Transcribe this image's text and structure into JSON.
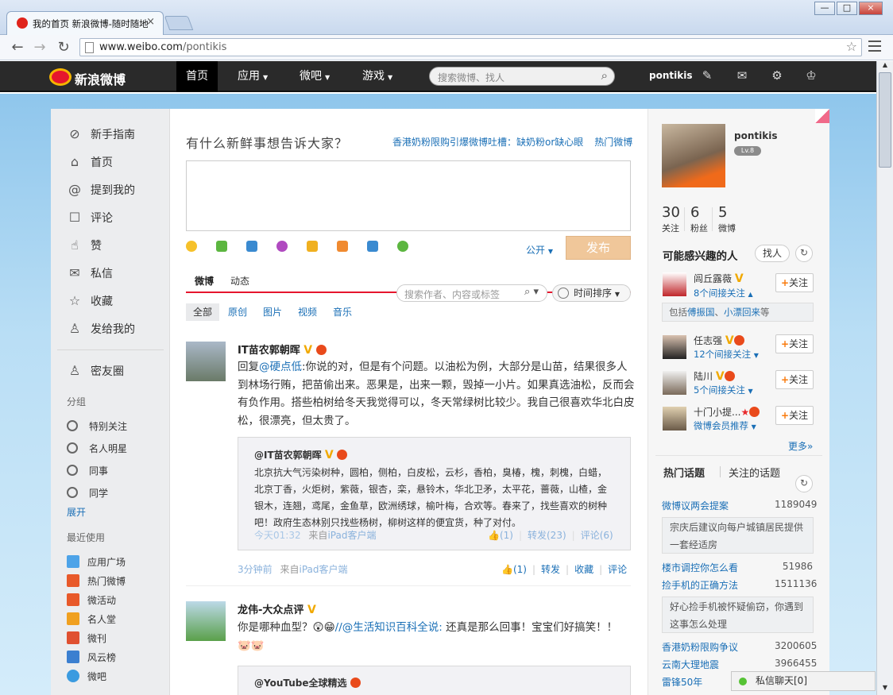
{
  "browser": {
    "tab_title": "我的首页 新浪微博-随时随地",
    "tab_close": "×",
    "url_host": "www.weibo.com",
    "url_path": "/pontikis",
    "min": "—",
    "max": "□",
    "close": "×"
  },
  "topnav": {
    "logo": "新浪微博",
    "items": [
      "首页",
      "应用",
      "微吧",
      "游戏"
    ],
    "search_placeholder": "搜索微博、找人",
    "username": "pontikis"
  },
  "leftnav": {
    "items": [
      {
        "icon": "compass-icon",
        "label": "新手指南"
      },
      {
        "icon": "home-icon",
        "label": "首页"
      },
      {
        "icon": "at-icon",
        "label": "提到我的"
      },
      {
        "icon": "comment-icon",
        "label": "评论"
      },
      {
        "icon": "thumb-up-icon",
        "label": "赞"
      },
      {
        "icon": "mail-icon",
        "label": "私信"
      },
      {
        "icon": "star-icon",
        "label": "收藏"
      },
      {
        "icon": "person-icon",
        "label": "发给我的"
      }
    ],
    "secret_friends": "密友圈",
    "group_title": "分组",
    "groups": [
      "特别关注",
      "名人明星",
      "同事",
      "同学"
    ],
    "expand": "展开",
    "recent_title": "最近使用",
    "apps": [
      {
        "label": "应用广场",
        "color": "#4da3e8"
      },
      {
        "label": "热门微博",
        "color": "#e8592a"
      },
      {
        "label": "微活动",
        "color": "#e8592a"
      },
      {
        "label": "名人堂",
        "color": "#f0a020"
      },
      {
        "label": "微刊",
        "color": "#e05030"
      },
      {
        "label": "风云榜",
        "color": "#3b7fd0"
      },
      {
        "label": "微吧",
        "color": "#3b9be0"
      }
    ]
  },
  "compose": {
    "prompt": "有什么新鲜事想告诉大家？",
    "hot_link": "香港奶粉限购引爆微博吐槽：缺奶粉or缺心眼",
    "hot_weibo": "热门微博",
    "visibility": "公开",
    "send": "发布"
  },
  "feed": {
    "tabs": [
      "微博",
      "动态"
    ],
    "search_placeholder": "搜索作者、内容或标签",
    "sort": "时间排序",
    "subtabs": [
      "全部",
      "原创",
      "图片",
      "视频",
      "音乐"
    ],
    "posts": [
      {
        "author": "IT苗农郭朝晖",
        "text_reply": "回复",
        "text_mention": "@硬点低",
        "text_body": ":你说的对，但是有个问题。以油松为例，大部分是山苗，结果很多人到林场行贿，把苗偷出来。恶果是，出来一颗，毁掉一小片。如果真选油松，反而会有负作用。搭些柏树给冬天我觉得可以，冬天常绿树比较少。我自己很喜欢华北白皮松，很漂亮，但太贵了。",
        "quote_author": "@IT苗农郭朝晖",
        "quote_text": "北京抗大气污染树种，圆柏，侧柏，白皮松，云杉，香柏，臭椿，槐，刺槐，白蜡，北京丁香，火炬树，紫薇，银杏，栾，悬铃木，华北卫矛，太平花，蔷薇，山楂，金银木，连翘，鸢尾，金鱼草，欧洲绣球，榆叶梅，合欢等。春来了，找些喜欢的树种吧！政府生态林别只找些杨树，柳树这样的便宜货，种了对付。",
        "quote_time": "今天01:32",
        "quote_from": "来自",
        "quote_client": "iPad客户端",
        "quote_like": "(1)",
        "quote_repost": "转发(23)",
        "quote_comment": "评论(6)",
        "time": "3分钟前",
        "from": "来自",
        "client": "iPad客户端",
        "like": "(1)",
        "repost": "转发",
        "fav": "收藏",
        "comment": "评论"
      },
      {
        "author": "龙伟-大众点评",
        "text_pre": "你是哪种血型？",
        "text_mention": "//@生活知识百科全说:",
        "text_post": " 还真是那么回事！宝宝们好搞笑！！",
        "quote_author": "@YouTube全球精选"
      }
    ]
  },
  "right": {
    "name": "pontikis",
    "level": "Lv.8",
    "stats": [
      {
        "n": "30",
        "l": "关注"
      },
      {
        "n": "6",
        "l": "粉丝"
      },
      {
        "n": "5",
        "l": "微博"
      }
    ],
    "interest_title": "可能感兴趣的人",
    "find": "找人",
    "suggest": [
      {
        "name": "闾丘露薇",
        "rel": "8个间接关注"
      },
      {
        "name": "任志强",
        "rel": "12个间接关注"
      },
      {
        "name": "陆川",
        "rel": "5个间接关注"
      },
      {
        "name": "十门小提...",
        "rel": "微博会员推荐"
      }
    ],
    "hint_pre": "包括",
    "hint_link1": "傅振国",
    "hint_sep": "、",
    "hint_link2": "小漂回来",
    "hint_post": "等",
    "follow": "关注",
    "more": "更多»",
    "hot_tabs": [
      "热门话题",
      "关注的话题"
    ],
    "topics": [
      {
        "name": "微博议两会提案",
        "count": "1189049",
        "desc": "宗庆后建议向每户城镇居民提供一套经适房"
      },
      {
        "name": "楼市调控你怎么看",
        "count": "51986"
      },
      {
        "name": "捡手机的正确方法",
        "count": "1511136",
        "desc": "好心捡手机被怀疑偷窃，你遇到这事怎么处理"
      },
      {
        "name": "香港奶粉限购争议",
        "count": "3200605"
      },
      {
        "name": "云南大理地震",
        "count": "3966455"
      },
      {
        "name": "雷锋50年",
        "count": ""
      }
    ]
  },
  "chat": {
    "label": "私信聊天[0]"
  }
}
